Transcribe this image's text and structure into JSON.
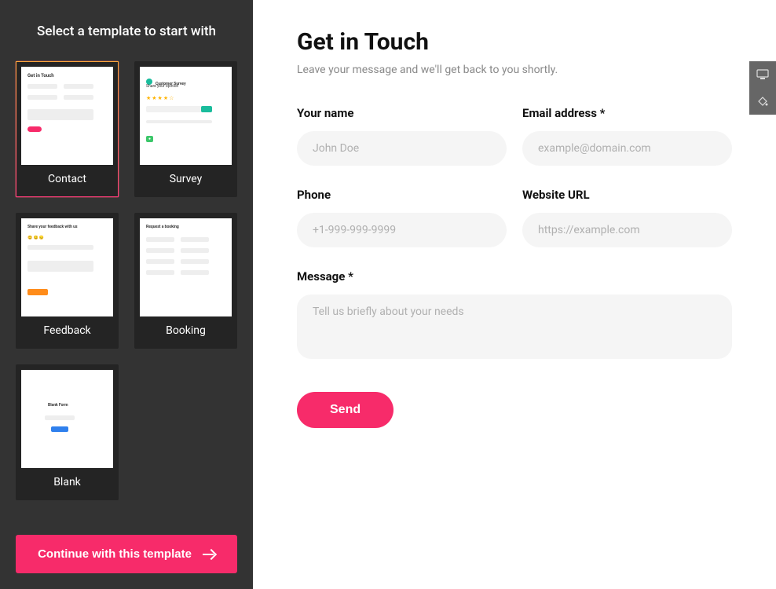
{
  "sidebar": {
    "title": "Select a template to start with",
    "templates": [
      {
        "label": "Contact",
        "selected": true
      },
      {
        "label": "Survey",
        "selected": false
      },
      {
        "label": "Feedback",
        "selected": false
      },
      {
        "label": "Booking",
        "selected": false
      },
      {
        "label": "Blank",
        "selected": false
      }
    ],
    "continue_label": "Continue with this template"
  },
  "form": {
    "title": "Get in Touch",
    "subtitle": "Leave your message and we'll get back to you shortly.",
    "fields": {
      "name": {
        "label": "Your name",
        "placeholder": "John Doe"
      },
      "email": {
        "label": "Email address *",
        "placeholder": "example@domain.com"
      },
      "phone": {
        "label": "Phone",
        "placeholder": "+1-999-999-9999"
      },
      "website": {
        "label": "Website URL",
        "placeholder": "https://example.com"
      },
      "message": {
        "label": "Message *",
        "placeholder": "Tell us briefly about your needs"
      }
    },
    "submit_label": "Send"
  },
  "preview_text": {
    "contact_title": "Get in Touch",
    "survey_title": "Customer Survey",
    "survey_sub": "Share your opinion",
    "feedback_title": "Share your feedback with us",
    "booking_title": "Request a booking",
    "blank_title": "Blank Form"
  }
}
